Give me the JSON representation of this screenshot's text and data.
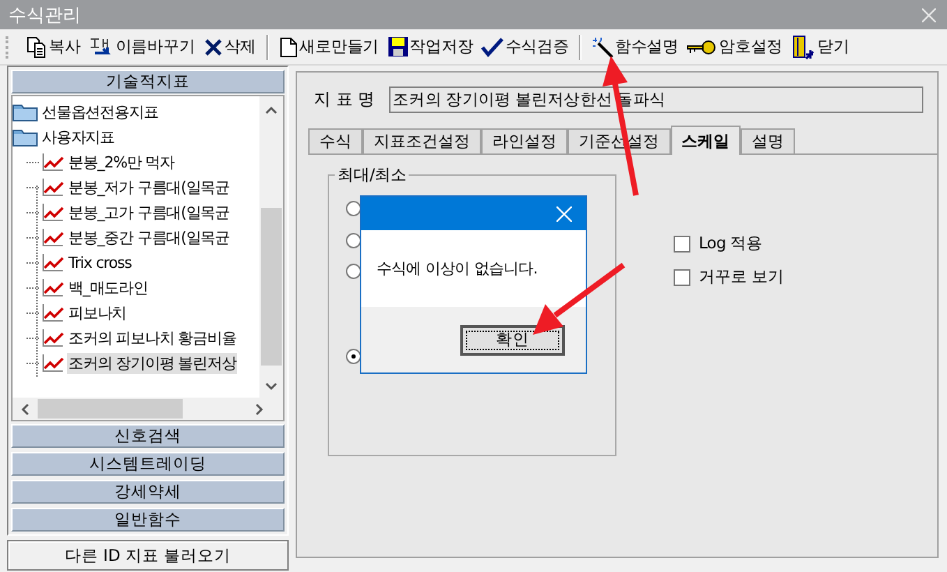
{
  "window": {
    "title": "수식관리"
  },
  "toolbar": [
    [
      {
        "kind": "copy",
        "label": "복사"
      },
      {
        "kind": "rename",
        "label": "이름바꾸기"
      },
      {
        "kind": "delete",
        "label": "삭제"
      }
    ],
    [
      {
        "kind": "new",
        "label": "새로만들기"
      },
      {
        "kind": "save",
        "label": "작업저장"
      },
      {
        "kind": "check",
        "label": "수식검증"
      }
    ],
    [
      {
        "kind": "wand",
        "label": "함수설명"
      },
      {
        "kind": "key",
        "label": "암호설정"
      },
      {
        "kind": "exit",
        "label": "닫기"
      }
    ]
  ],
  "sidebar": {
    "header": "기술적지표",
    "tree": [
      {
        "kind": "folder",
        "label": "선물옵션전용지표",
        "selected": false
      },
      {
        "kind": "folder",
        "label": "사용자지표",
        "selected": false,
        "children": [
          {
            "kind": "indicator",
            "label": "분봉_2%만 먹자",
            "selected": false
          },
          {
            "kind": "indicator",
            "label": "분봉_저가 구름대(일목균",
            "selected": false
          },
          {
            "kind": "indicator",
            "label": "분봉_고가 구름대(일목균",
            "selected": false
          },
          {
            "kind": "indicator",
            "label": "분봉_중간 구름대(일목균",
            "selected": false
          },
          {
            "kind": "indicator",
            "label": "Trix cross",
            "selected": false
          },
          {
            "kind": "indicator",
            "label": "백_매도라인",
            "selected": false
          },
          {
            "kind": "indicator",
            "label": "피보나치",
            "selected": false
          },
          {
            "kind": "indicator",
            "label": "조커의 피보나치 황금비율",
            "selected": false
          },
          {
            "kind": "indicator",
            "label": "조커의 장기이평 볼린저상",
            "selected": true
          }
        ]
      }
    ],
    "sections": [
      "신호검색",
      "시스템트레이딩",
      "강세약세",
      "일반함수"
    ],
    "load_button": "다른 ID 지표 불러오기"
  },
  "editor": {
    "name_label": "지 표 명",
    "name_value": "조커의 장기이평 볼린저상한선 돌파식",
    "tabs": [
      {
        "label": "수식",
        "selected": false
      },
      {
        "label": "지표조건설정",
        "selected": false
      },
      {
        "label": "라인설정",
        "selected": false
      },
      {
        "label": "기준선설정",
        "selected": false
      },
      {
        "label": "스케일",
        "selected": true
      },
      {
        "label": "설명",
        "selected": false
      }
    ],
    "group_title": "최대/최소",
    "radios": [
      {
        "selected": false
      },
      {
        "selected": false
      },
      {
        "selected": false
      },
      {
        "selected": true
      }
    ],
    "checkboxes": [
      {
        "label": "Log 적용",
        "checked": false
      },
      {
        "label": "거꾸로 보기",
        "checked": false
      }
    ]
  },
  "dialog": {
    "message": "수식에 이상이 없습니다.",
    "ok": "확인"
  }
}
